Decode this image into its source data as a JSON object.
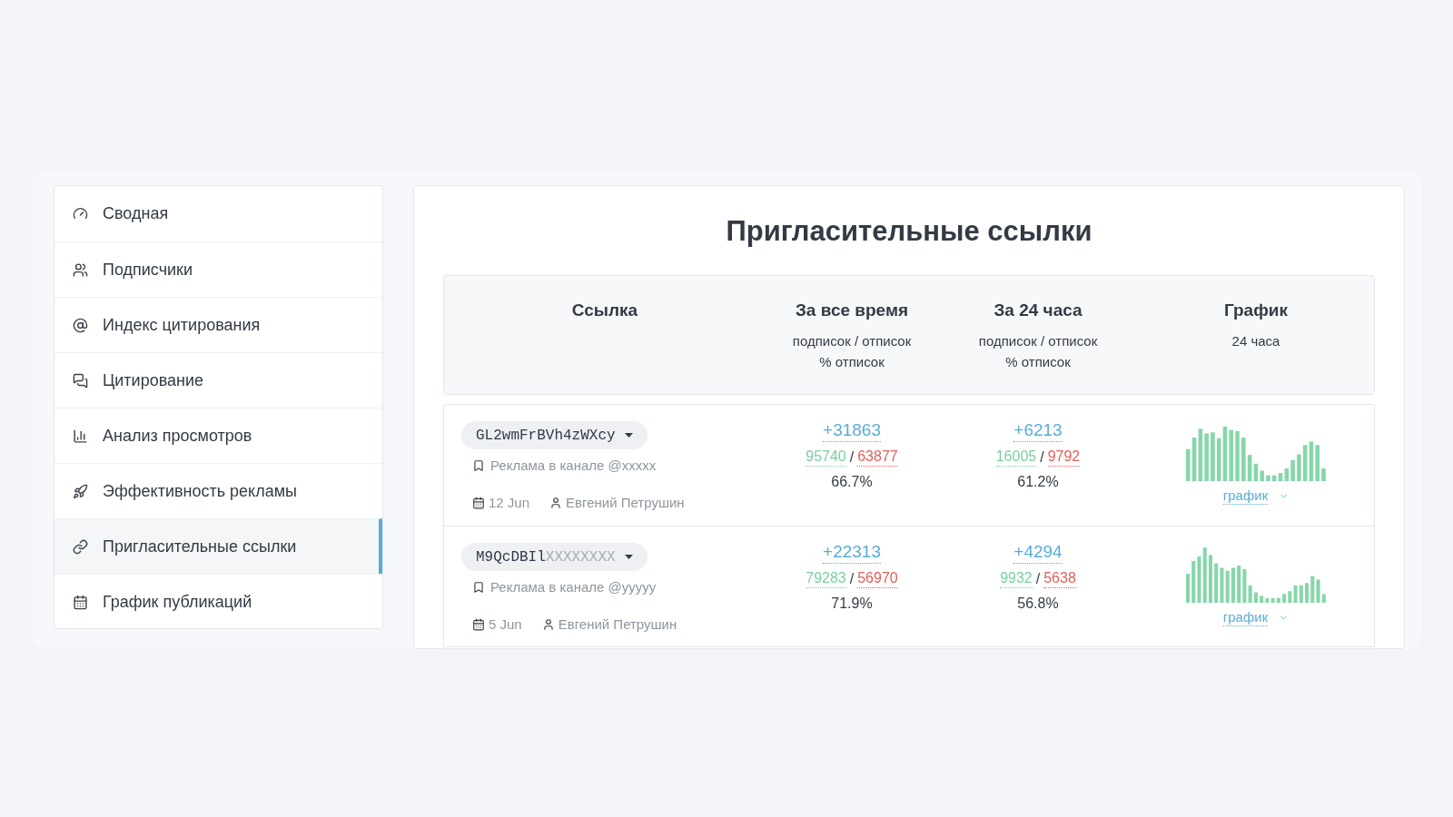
{
  "sidebar": {
    "items": [
      {
        "label": "Сводная",
        "selected": false
      },
      {
        "label": "Подписчики",
        "selected": false
      },
      {
        "label": "Индекс цитирования",
        "selected": false
      },
      {
        "label": "Цитирование",
        "selected": false
      },
      {
        "label": "Анализ просмотров",
        "selected": false
      },
      {
        "label": "Эффективность рекламы",
        "selected": false
      },
      {
        "label": "Пригласительные ссылки",
        "selected": true
      },
      {
        "label": "График публикаций",
        "selected": false
      }
    ]
  },
  "main": {
    "title": "Пригласительные ссылки",
    "table": {
      "columns": [
        {
          "title": "Ссылка"
        },
        {
          "title": "За все время",
          "sub": [
            "подписок / отписок",
            "% отписок"
          ]
        },
        {
          "title": "За 24 часа",
          "sub": [
            "подписок / отписок",
            "% отписок"
          ]
        },
        {
          "title": "График",
          "sub": [
            "24 часа"
          ]
        }
      ],
      "rows": [
        {
          "link": {
            "visible": "GL2wmFrBVh4zWXcy"
          },
          "channel": "Реклама в канале @xxxxx",
          "date": "12 Jun",
          "author": "Евгений Петрушин",
          "all_time": {
            "net": "+31863",
            "subs": "95740",
            "separator": "/",
            "unsubs": "63877",
            "percent": "66.7%"
          },
          "day": {
            "net": "+6213",
            "subs": "16005",
            "separator": "/",
            "unsubs": "9792",
            "percent": "61.2%"
          },
          "chart_link": "график"
        },
        {
          "link": {
            "visible": "M9QcDBIl",
            "masked": "XXXXXXXX"
          },
          "channel": "Реклама в канале @yyyyy",
          "date": "5 Jun",
          "author": "Евгений Петрушин",
          "all_time": {
            "net": "+22313",
            "subs": "79283",
            "separator": "/",
            "unsubs": "56970",
            "percent": "71.9%"
          },
          "day": {
            "net": "+4294",
            "subs": "9932",
            "separator": "/",
            "unsubs": "5638",
            "percent": "56.8%"
          },
          "chart_link": "график"
        }
      ]
    }
  }
}
